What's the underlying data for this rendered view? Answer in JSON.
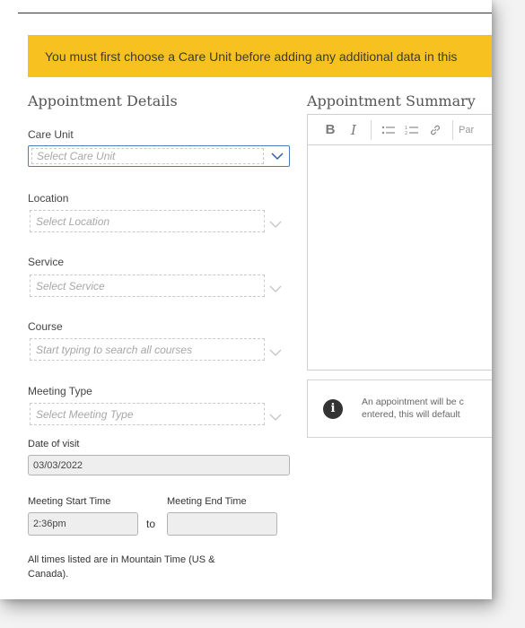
{
  "banner": {
    "text": "You must first choose a Care Unit before adding any additional data in this"
  },
  "details": {
    "title": "Appointment Details",
    "care_unit": {
      "label": "Care Unit",
      "placeholder": "Select Care Unit"
    },
    "location": {
      "label": "Location",
      "placeholder": "Select Location"
    },
    "service": {
      "label": "Service",
      "placeholder": "Select Service"
    },
    "course": {
      "label": "Course",
      "placeholder": "Start typing to search all courses"
    },
    "meeting_type": {
      "label": "Meeting Type",
      "placeholder": "Select Meeting Type"
    },
    "date_of_visit": {
      "label": "Date of visit",
      "value": "03/03/2022"
    },
    "start_time": {
      "label": "Meeting Start Time",
      "value": "2:36pm"
    },
    "to_label": "to",
    "end_time": {
      "label": "Meeting End Time",
      "value": ""
    },
    "timezone_note_line1": "All times listed are in Mountain Time (US &",
    "timezone_note_line2": "Canada)."
  },
  "summary": {
    "title": "Appointment Summary",
    "toolbar": {
      "bold": "B",
      "italic": "I",
      "paragraph": "Par"
    },
    "info_line1": "An appointment will be c",
    "info_line2": "entered, this will default"
  },
  "colors": {
    "banner": "#f7c21f",
    "focus_border": "#4a7cc4",
    "info_icon": "#333333"
  }
}
